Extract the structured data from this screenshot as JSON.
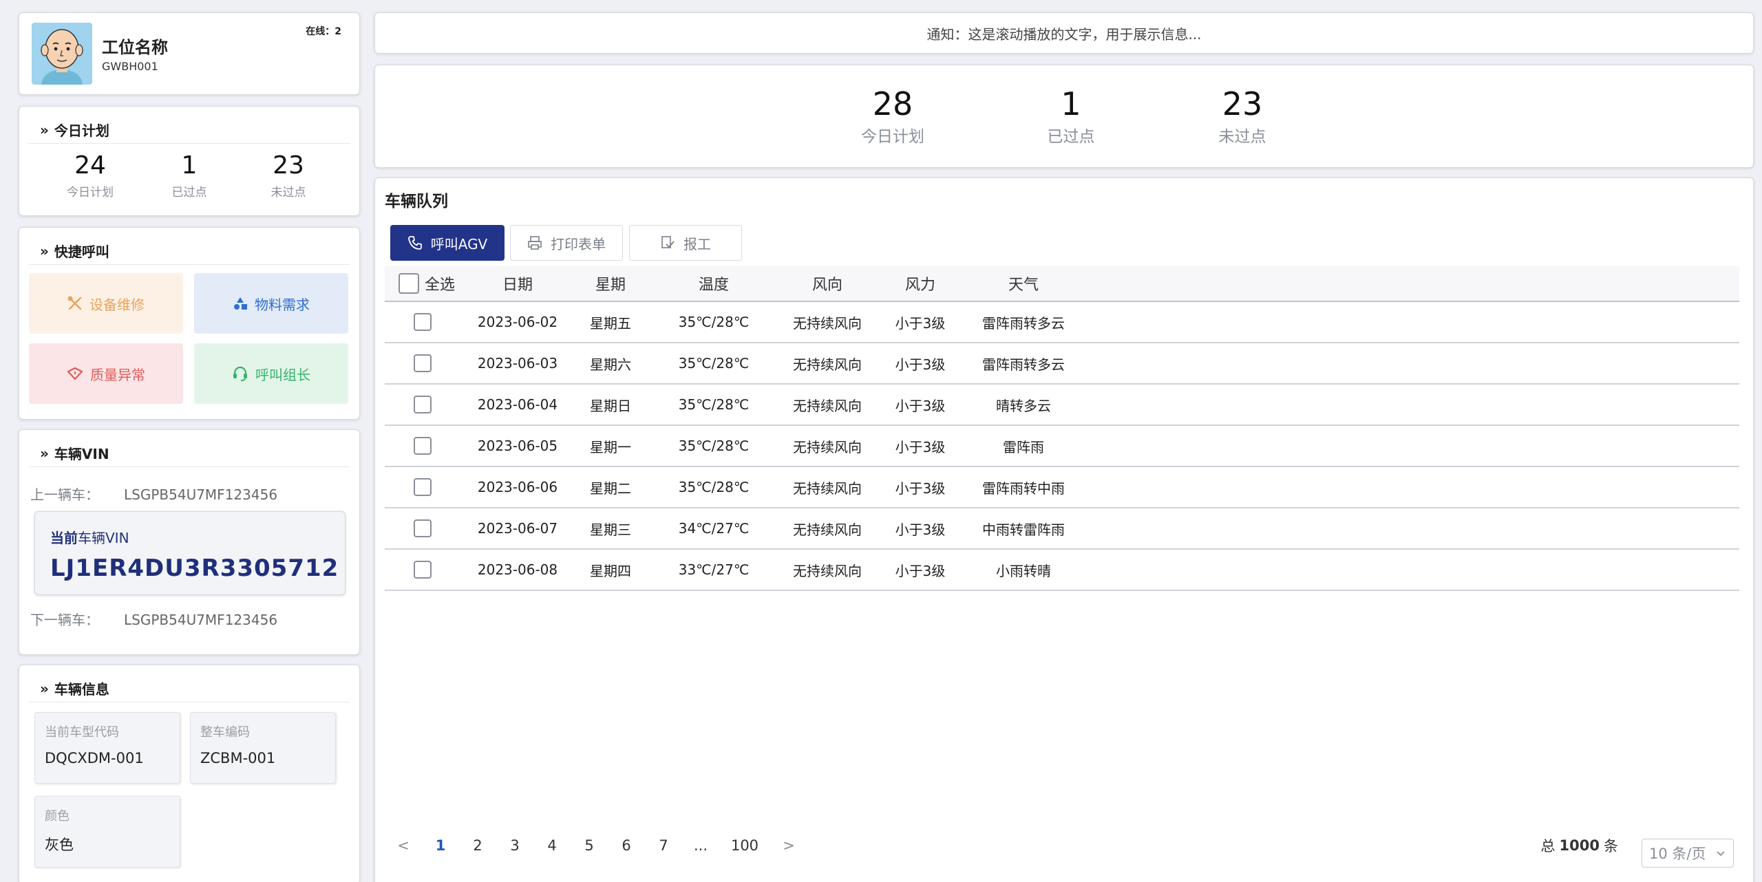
{
  "profile": {
    "name": "工位名称",
    "code": "GWBH001",
    "online": "在线：2"
  },
  "plan": {
    "title": "今日计划",
    "stats": [
      {
        "value": "24",
        "label": "今日计划"
      },
      {
        "value": "1",
        "label": "已过点"
      },
      {
        "value": "23",
        "label": "未过点"
      }
    ]
  },
  "quick": {
    "title": "快捷呼叫",
    "buttons": [
      {
        "label": "设备维修",
        "icon": "tools-icon",
        "color": "#e8a35a",
        "bg": "#fdf1e6"
      },
      {
        "label": "物料需求",
        "icon": "shapes-icon",
        "color": "#2f6fd0",
        "bg": "#e3ebf8"
      },
      {
        "label": "质量异常",
        "icon": "warning-tag-icon",
        "color": "#e05a5a",
        "bg": "#fbe5e6"
      },
      {
        "label": "呼叫组长",
        "icon": "headset-icon",
        "color": "#34b36a",
        "bg": "#e3f5e9"
      }
    ]
  },
  "vin": {
    "title": "车辆VIN",
    "prev_label": "上一辆车：",
    "prev_value": "LSGPB54U7MF123456",
    "current_label_a": "当前",
    "current_label_b": "车辆VIN",
    "current_value": "LJ1ER4DU3R3305712",
    "next_label": "下一辆车：",
    "next_value": "LSGPB54U7MF123456"
  },
  "vehicle_info": {
    "title": "车辆信息",
    "items": [
      {
        "label": "当前车型代码",
        "value": "DQCXDM-001"
      },
      {
        "label": "整车编码",
        "value": "ZCBM-001"
      },
      {
        "label": "颜色",
        "value": "灰色"
      }
    ]
  },
  "notice": "通知：这是滚动播放的文字，用于展示信息...",
  "big_stats": [
    {
      "value": "28",
      "label": "今日计划"
    },
    {
      "value": "1",
      "label": "已过点"
    },
    {
      "value": "23",
      "label": "未过点"
    }
  ],
  "queue": {
    "title": "车辆队列",
    "actions": [
      {
        "label": "呼叫AGV",
        "icon": "phone-icon"
      },
      {
        "label": "打印表单",
        "icon": "printer-icon"
      },
      {
        "label": "报工",
        "icon": "report-icon"
      }
    ],
    "select_all": "全选",
    "columns": [
      "日期",
      "星期",
      "温度",
      "风向",
      "风力",
      "天气"
    ],
    "rows": [
      [
        "2023-06-02",
        "星期五",
        "35℃/28℃",
        "无持续风向",
        "小于3级",
        "雷阵雨转多云"
      ],
      [
        "2023-06-03",
        "星期六",
        "35℃/28℃",
        "无持续风向",
        "小于3级",
        "雷阵雨转多云"
      ],
      [
        "2023-06-04",
        "星期日",
        "35℃/28℃",
        "无持续风向",
        "小于3级",
        "晴转多云"
      ],
      [
        "2023-06-05",
        "星期一",
        "35℃/28℃",
        "无持续风向",
        "小于3级",
        "雷阵雨"
      ],
      [
        "2023-06-06",
        "星期二",
        "35℃/28℃",
        "无持续风向",
        "小于3级",
        "雷阵雨转中雨"
      ],
      [
        "2023-06-07",
        "星期三",
        "34℃/27℃",
        "无持续风向",
        "小于3级",
        "中雨转雷阵雨"
      ],
      [
        "2023-06-08",
        "星期四",
        "33℃/27℃",
        "无持续风向",
        "小于3级",
        "小雨转晴"
      ]
    ]
  },
  "pagination": {
    "prev": "<",
    "pages": [
      "1",
      "2",
      "3",
      "4",
      "5",
      "6",
      "7",
      "...",
      "100"
    ],
    "current": "1",
    "next": ">",
    "total_prefix": "总",
    "total": "1000",
    "total_suffix": "条",
    "page_size": "10 条/页"
  }
}
